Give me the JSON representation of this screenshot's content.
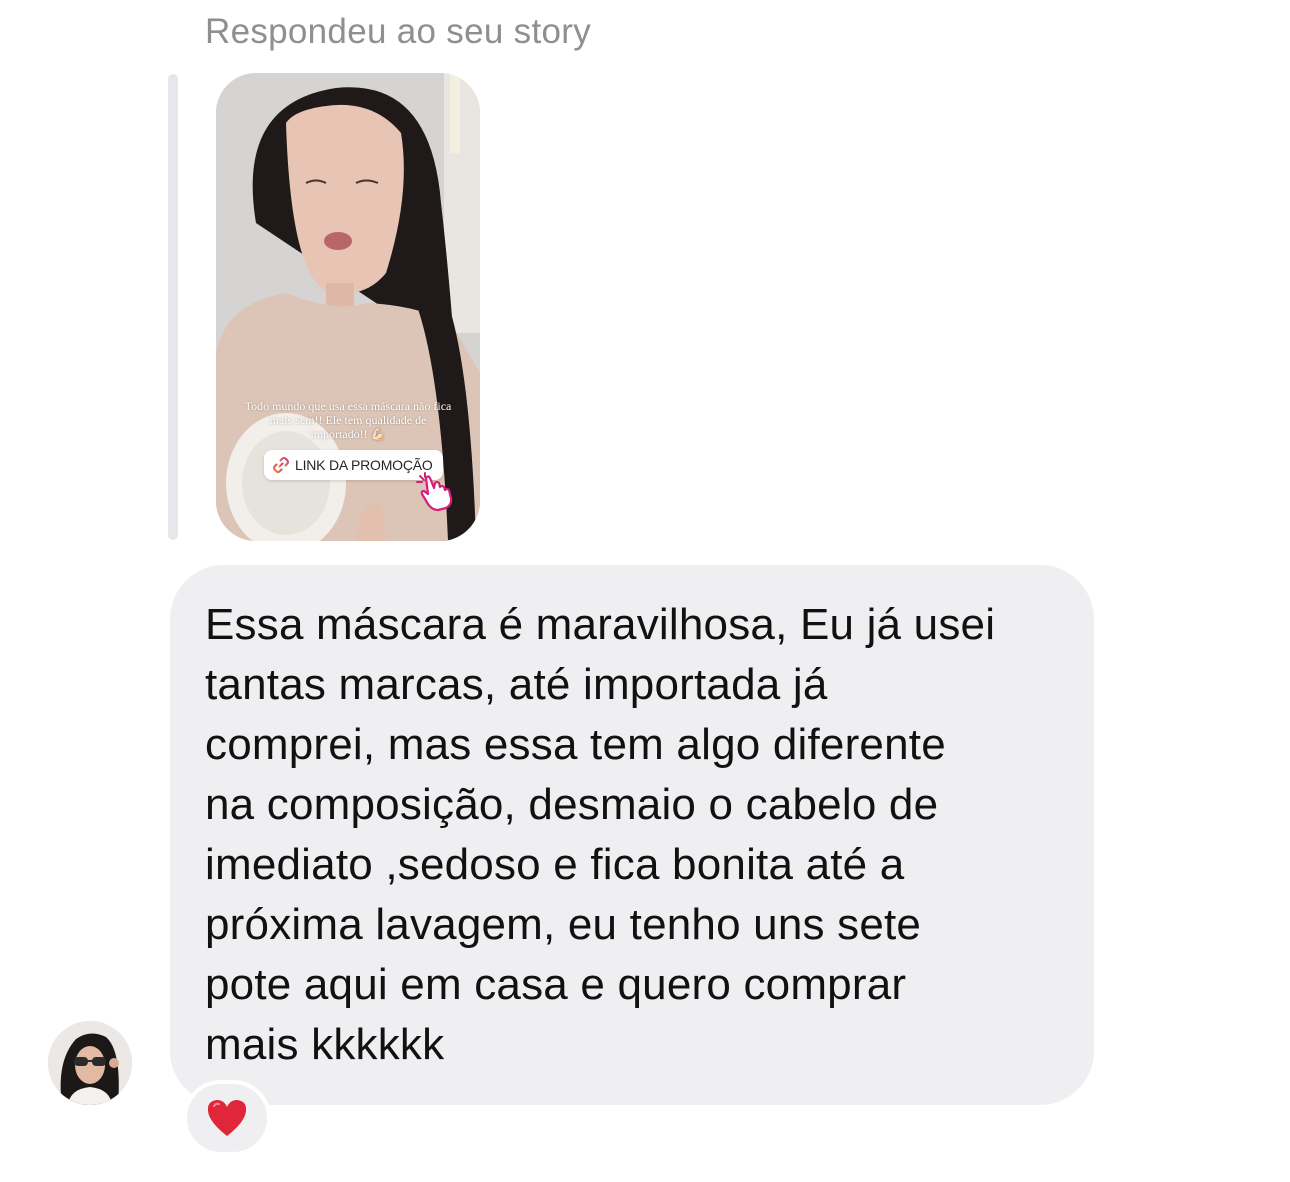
{
  "story_reply": {
    "label": "Respondeu ao seu story",
    "caption": "Todo mundo que usa essa máscara não fica mais sem!! Ele tem qualidade de importado!! 💪🏻",
    "link_sticker_label": "LINK DA PROMOÇÃO"
  },
  "message": {
    "lines": [
      "Essa máscara é maravilhosa, Eu já usei",
      "tantas marcas, até importada já",
      "comprei, mas essa tem algo diferente",
      "na composição, desmaio o cabelo de",
      "imediato ,sedoso e fica bonita até a",
      "próxima lavagem, eu tenho uns sete",
      "pote aqui em casa e quero comprar",
      "mais kkkkkk"
    ],
    "reaction": "❤️"
  },
  "colors": {
    "bubble_background": "#efeff2",
    "label_gray": "#8e8e93",
    "heart_red": "#e0263a",
    "link_gradient_start": "#f58529",
    "link_gradient_end": "#c13584"
  },
  "icons": {
    "link": "link-icon",
    "hand": "pointing-hand-icon",
    "reaction": "red-heart-icon"
  }
}
